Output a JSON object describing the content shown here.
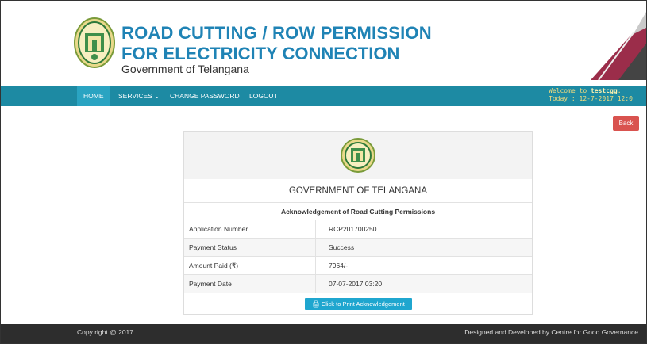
{
  "header": {
    "title_line1": "ROAD CUTTING / ROW PERMISSION",
    "title_line2": "FOR ELECTRICITY CONNECTION",
    "subtitle": "Government of Telangana"
  },
  "nav": {
    "items": [
      {
        "label": "HOME"
      },
      {
        "label": "SERVICES ⌄"
      },
      {
        "label": "CHANGE PASSWORD"
      },
      {
        "label": "LOGOUT"
      }
    ],
    "welcome_prefix": "Welcome to ",
    "welcome_user": "testcgg",
    "welcome_suffix": ":",
    "today": "Today : 12-7-2017 12:0"
  },
  "back_label": "Back",
  "card": {
    "title": "GOVERNMENT OF TELANGANA",
    "subheading": "Acknowledgement of Road Cutting Permissions",
    "rows": [
      {
        "label": "Application Number",
        "value": "RCP201700250"
      },
      {
        "label": "Payment Status",
        "value": "Success"
      },
      {
        "label": "Amount Paid (₹)",
        "value": "7964/-"
      },
      {
        "label": "Payment Date",
        "value": "07-07-2017 03:20"
      }
    ],
    "print_label": "🖨 Click to Print Acknowledgement"
  },
  "footer": {
    "copyright": "Copy right @ 2017.",
    "credit": "Designed and Developed by Centre for Good Governance"
  },
  "colors": {
    "brand_blue": "#1f83b5",
    "nav_bg": "#1d8aa3",
    "back_red": "#d9534f",
    "print_blue": "#1fa6cf"
  }
}
